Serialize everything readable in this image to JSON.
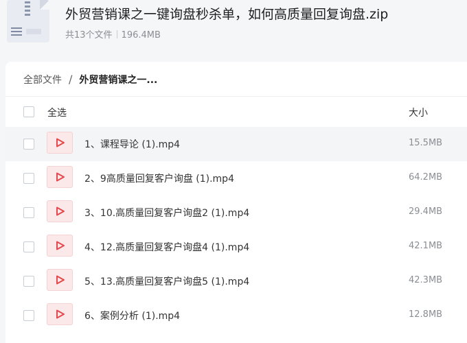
{
  "header": {
    "title": "外贸营销课之一键询盘秒杀单，如何高质量回复询盘.zip",
    "file_count": "共13个文件",
    "total_size": "196.4MB"
  },
  "breadcrumb": {
    "root": "全部文件",
    "separator": "/",
    "current": "外贸营销课之一..."
  },
  "list": {
    "select_all_label": "全选",
    "size_header": "大小",
    "files": [
      {
        "name": "1、课程导论 (1).mp4",
        "size": "15.5MB"
      },
      {
        "name": "2、9高质量回复客户询盘 (1).mp4",
        "size": "64.2MB"
      },
      {
        "name": "3、10.高质量回复客户询盘2 (1).mp4",
        "size": "29.4MB"
      },
      {
        "name": "4、12.高质量回复客户询盘4 (1).mp4",
        "size": "42.1MB"
      },
      {
        "name": "5、13.高质量回复客户询盘5 (1).mp4",
        "size": "42.3MB"
      },
      {
        "name": "6、案例分析 (1).mp4",
        "size": "12.8MB"
      }
    ]
  },
  "icons": {
    "archive": "zip-archive-icon",
    "video": "video-play-icon"
  },
  "colors": {
    "video_icon_bg": "#fbe9ea",
    "video_icon_fg": "#e5484d",
    "hover_row_bg": "#f4f5f7"
  }
}
